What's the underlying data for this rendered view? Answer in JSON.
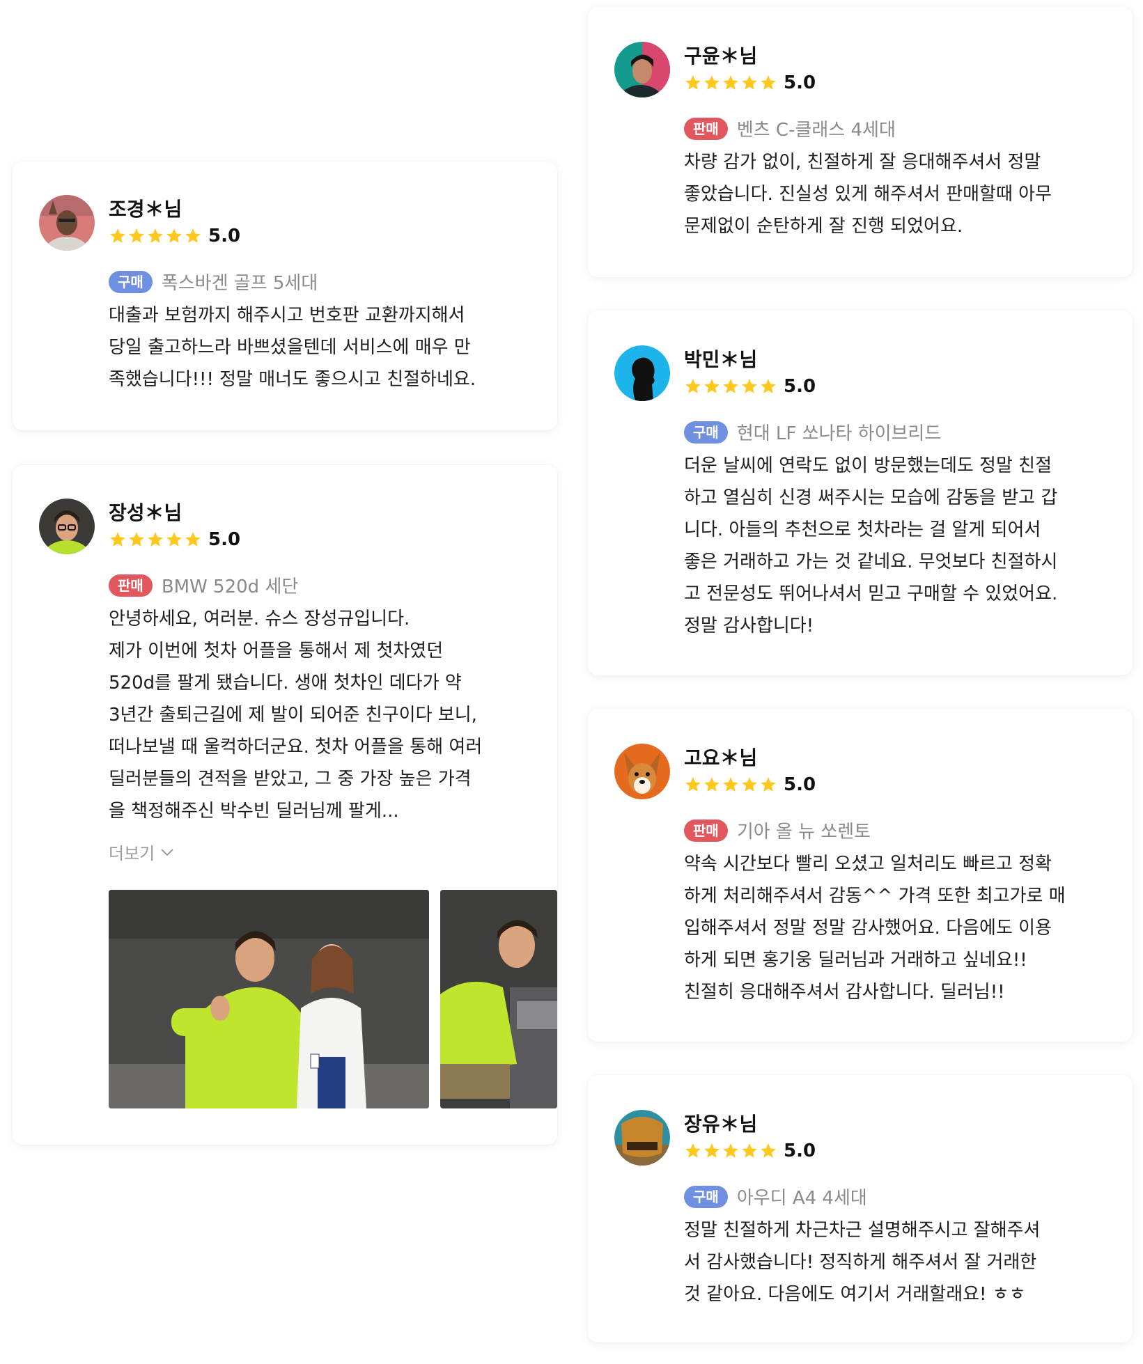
{
  "colors": {
    "buy": "#6f8fe0",
    "sell": "#e0575e",
    "star": "#ffc81f"
  },
  "reviews": [
    {
      "name": "조경＊님",
      "score": "5.0",
      "stars": 5,
      "badge": "구매",
      "badge_type": "buy",
      "car": "폭스바겐 골프 5세대",
      "lines": [
        "대출과 보험까지 해주시고 번호판 교환까지해서",
        "당일 출고하느라 바쁘셨을텐데 서비스에 매우 만",
        "족했습니다!!! 정말 매너도 좋으시고 친절하네요."
      ],
      "avatar_icon": "person-avatar-icon"
    },
    {
      "name": "장성＊님",
      "score": "5.0",
      "stars": 5,
      "badge": "판매",
      "badge_type": "sell",
      "car": "BMW 520d 세단",
      "lines": [
        "안녕하세요, 여러분. 슈스 장성규입니다.",
        "제가 이번에 첫차 어플을 통해서 제 첫차였던",
        "520d를 팔게 됐습니다. 생애 첫차인 데다가 약",
        "3년간 출퇴근길에 제 발이 되어준 친구이다 보니,",
        "떠나보낼 때 울컥하더군요. 첫차 어플을 통해 여러",
        "딜러분들의 견적을 받았고, 그 중 가장 높은 가격",
        "을 책정해주신 박수빈 딜러님께 팔게..."
      ],
      "more": "더보기",
      "avatar_icon": "person-avatar-icon"
    },
    {
      "name": "구윤＊님",
      "score": "5.0",
      "stars": 5,
      "badge": "판매",
      "badge_type": "sell",
      "car": "벤츠 C-클래스 4세대",
      "lines": [
        "차량 감가 없이, 친절하게 잘 응대해주셔서 정말",
        "좋았습니다. 진실성 있게 해주셔서 판매할때 아무",
        "문제없이 순탄하게 잘 진행 되었어요."
      ],
      "avatar_icon": "person-avatar-icon"
    },
    {
      "name": "박민＊님",
      "score": "5.0",
      "stars": 5,
      "badge": "구매",
      "badge_type": "buy",
      "car": "현대 LF 쏘나타 하이브리드",
      "lines": [
        "더운 날씨에 연락도 없이 방문했는데도 정말 친절",
        "하고 열심히 신경 써주시는 모습에 감동을 받고 갑",
        "니다. 아들의 추천으로 첫차라는 걸 알게 되어서",
        "좋은 거래하고 가는 것 같네요. 무엇보다 친절하시",
        "고 전문성도 뛰어나셔서 믿고 구매할 수 있었어요.",
        "정말 감사합니다!"
      ],
      "avatar_icon": "silhouette-avatar-icon"
    },
    {
      "name": "고요＊님",
      "score": "5.0",
      "stars": 5,
      "badge": "판매",
      "badge_type": "sell",
      "car": "기아 올 뉴 쏘렌토",
      "lines": [
        "약속 시간보다 빨리 오셨고 일처리도 빠르고 정확",
        "하게 처리해주셔서 감동^^ 가격 또한 최고가로 매",
        "입해주셔서 정말 정말 감사했어요. 다음에도 이용",
        "하게 되면 홍기웅 딜러님과 거래하고 싶네요!!",
        "친절히 응대해주셔서 감사합니다. 딜러님!!"
      ],
      "avatar_icon": "dog-avatar-icon"
    },
    {
      "name": "장유＊님",
      "score": "5.0",
      "stars": 5,
      "badge": "구매",
      "badge_type": "buy",
      "car": "아우디 A4 4세대",
      "lines": [
        "정말 친절하게 차근차근 설명해주시고 잘해주셔",
        "서 감사했습니다! 정직하게 해주셔서 잘 거래한",
        "것 같아요. 다음에도 여기서 거래할래요! ㅎㅎ"
      ],
      "avatar_icon": "misfits-logo-avatar-icon"
    }
  ]
}
